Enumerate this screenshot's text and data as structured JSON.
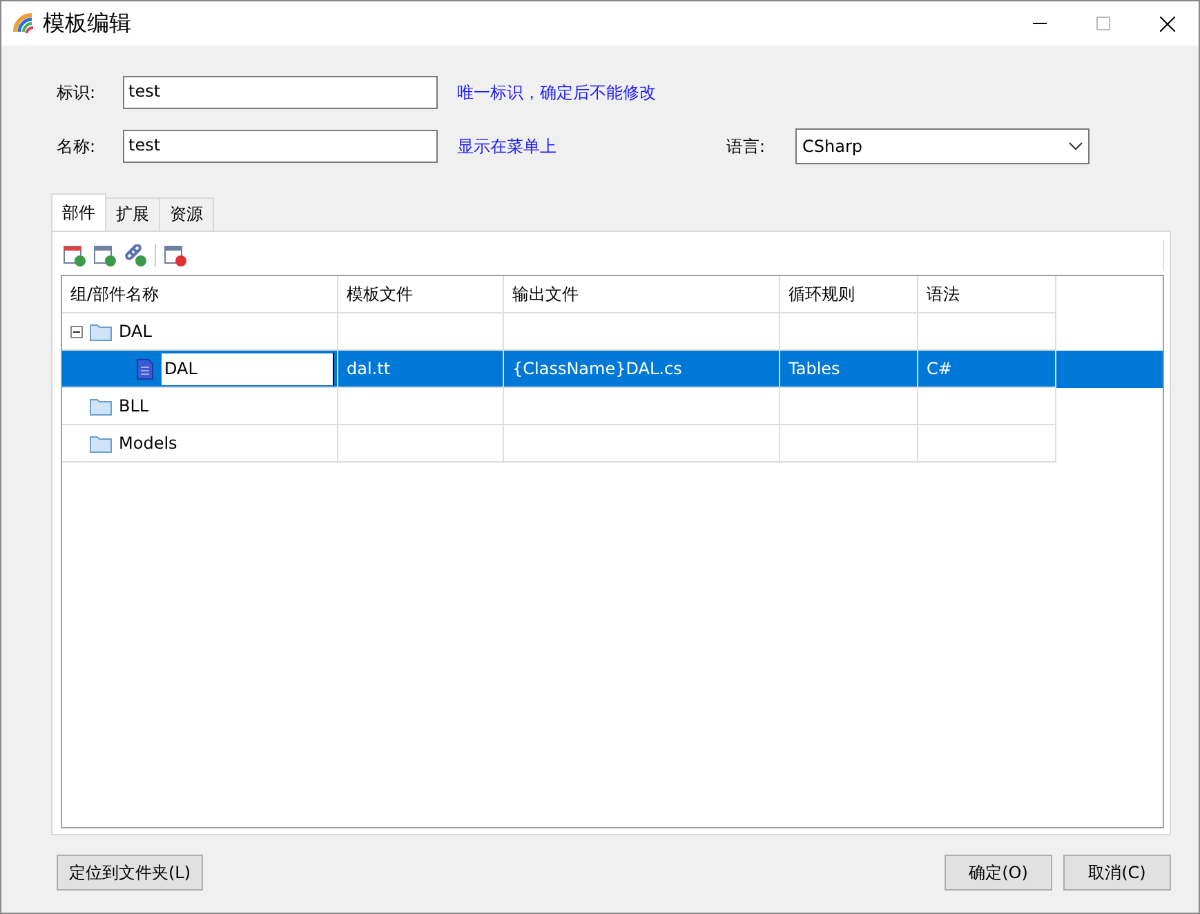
{
  "window": {
    "title": "模板编辑"
  },
  "form": {
    "id_label": "标识:",
    "id_value": "test",
    "id_hint": "唯一标识，确定后不能修改",
    "name_label": "名称:",
    "name_value": "test",
    "name_hint": "显示在菜单上",
    "language_label": "语言:",
    "language_value": "CSharp"
  },
  "tabs": [
    {
      "label": "部件",
      "selected": true
    },
    {
      "label": "扩展",
      "selected": false
    },
    {
      "label": "资源",
      "selected": false
    }
  ],
  "table": {
    "columns": [
      "组/部件名称",
      "模板文件",
      "输出文件",
      "循环规则",
      "语法"
    ],
    "rows": [
      {
        "name": "DAL",
        "kind": "group",
        "selected": false,
        "expanded": true,
        "cells": [
          "",
          "",
          "",
          ""
        ],
        "children": [
          {
            "name": "DAL",
            "kind": "part",
            "selected": true,
            "editing": true,
            "cells": [
              "dal.tt",
              "{ClassName}DAL.cs",
              "Tables",
              "C#"
            ]
          }
        ]
      },
      {
        "name": "BLL",
        "kind": "group",
        "selected": false,
        "cells": [
          "",
          "",
          "",
          ""
        ]
      },
      {
        "name": "Models",
        "kind": "group",
        "selected": false,
        "cells": [
          "",
          "",
          "",
          ""
        ]
      }
    ]
  },
  "buttons": {
    "locate": "定位到文件夹(L)",
    "ok": "确定(O)",
    "cancel": "取消(C)"
  }
}
